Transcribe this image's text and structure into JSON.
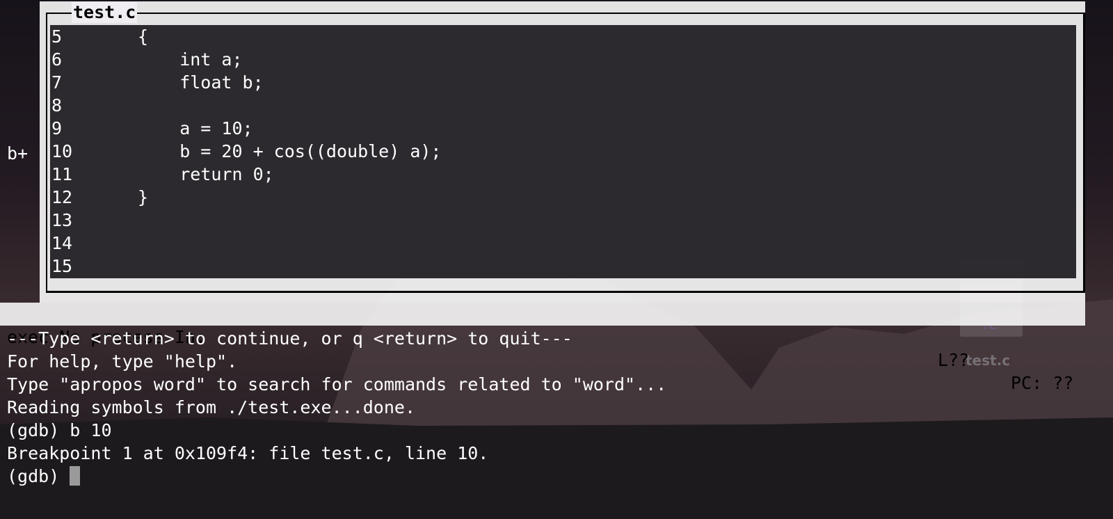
{
  "source_window": {
    "title": "test.c",
    "breakpoint_marker": "b+",
    "lines": [
      {
        "num": "5",
        "code": "{"
      },
      {
        "num": "6",
        "code": "    int a;"
      },
      {
        "num": "7",
        "code": "    float b;"
      },
      {
        "num": "8",
        "code": ""
      },
      {
        "num": "9",
        "code": "    a = 10;"
      },
      {
        "num": "10",
        "code": "    b = 20 + cos((double) a);"
      },
      {
        "num": "11",
        "code": "    return 0;"
      },
      {
        "num": "12",
        "code": "}"
      },
      {
        "num": "13",
        "code": ""
      },
      {
        "num": "14",
        "code": ""
      },
      {
        "num": "15",
        "code": ""
      }
    ]
  },
  "status_bar": {
    "left": "exec No process In:",
    "line": "L??",
    "pc": "PC: ??"
  },
  "command_output": [
    "---Type <return> to continue, or q <return> to quit---",
    "For help, type \"help\".",
    "Type \"apropos word\" to search for commands related to \"word\"...",
    "Reading symbols from ./test.exe...done.",
    "(gdb) b 10",
    "Breakpoint 1 at 0x109f4: file test.c, line 10."
  ],
  "prompt": "(gdb) ",
  "desktop": {
    "file_icon_ext": ".c",
    "file_icon_label": "test.c"
  }
}
